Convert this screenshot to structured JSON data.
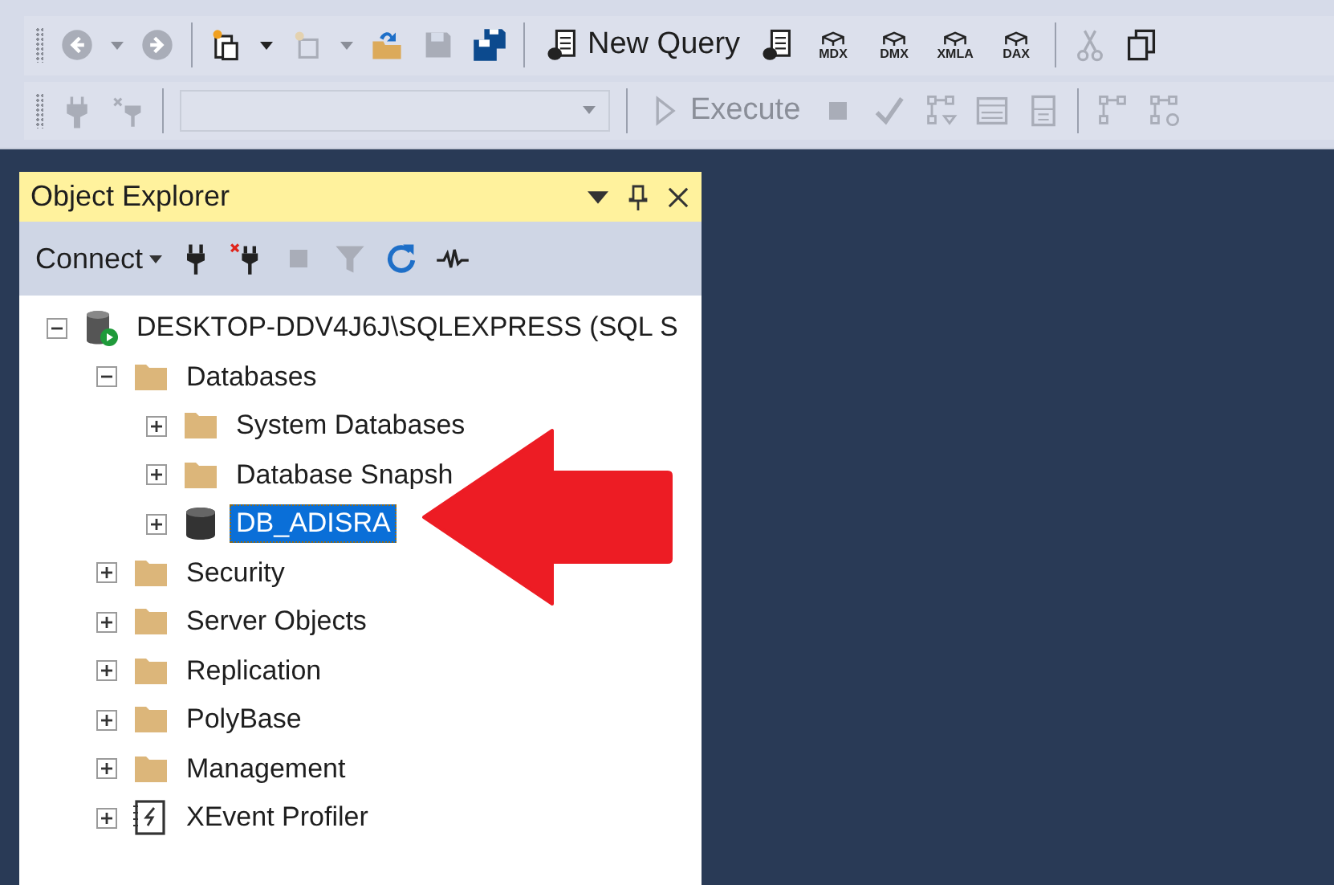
{
  "toolbar": {
    "new_query": {
      "label": "New Query"
    },
    "query_type_buttons": [
      {
        "label": "MDX"
      },
      {
        "label": "DMX"
      },
      {
        "label": "XMLA"
      },
      {
        "label": "DAX"
      }
    ],
    "database_selector": {
      "disabled": true
    },
    "execute": {
      "label": "Execute",
      "disabled": true
    }
  },
  "object_explorer": {
    "title": "Object Explorer",
    "connect": {
      "label": "Connect"
    },
    "tree": [
      {
        "label": "DESKTOP-DDV4J6J\\SQLEXPRESS (SQL S",
        "kind": "server",
        "expanded": true,
        "selected": false,
        "children": [
          {
            "label": "Databases",
            "kind": "folder",
            "expanded": true,
            "selected": false,
            "children": [
              {
                "label": "System Databases",
                "kind": "folder",
                "expanded": false,
                "selected": false
              },
              {
                "label": "Database Snapsh",
                "kind": "folder",
                "expanded": false,
                "selected": false
              },
              {
                "label": "DB_ADISRA",
                "kind": "database",
                "expanded": false,
                "selected": true
              }
            ]
          },
          {
            "label": "Security",
            "kind": "folder",
            "expanded": false,
            "selected": false
          },
          {
            "label": "Server Objects",
            "kind": "folder",
            "expanded": false,
            "selected": false
          },
          {
            "label": "Replication",
            "kind": "folder",
            "expanded": false,
            "selected": false
          },
          {
            "label": "PolyBase",
            "kind": "folder",
            "expanded": false,
            "selected": false
          },
          {
            "label": "Management",
            "kind": "folder",
            "expanded": false,
            "selected": false
          },
          {
            "label": "XEvent Profiler",
            "kind": "profiler",
            "expanded": false,
            "selected": false
          }
        ]
      }
    ]
  }
}
